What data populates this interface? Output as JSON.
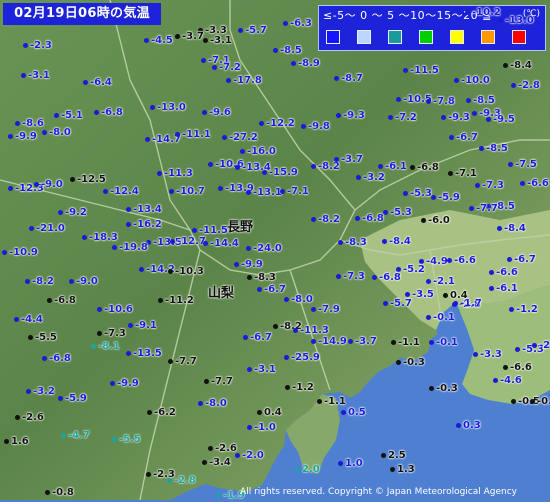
{
  "title": "02月19日06時の気温",
  "legend": {
    "scale_text": "≤-5〜 0 〜 5 〜10〜15〜20 ≦",
    "unit": "(℃)",
    "swatches": [
      {
        "name": "lt-neg5",
        "color": "#1414ff"
      },
      {
        "name": "neg5-0",
        "color": "#b9d7ff"
      },
      {
        "name": "0-5",
        "color": "#1a9a9a"
      },
      {
        "name": "5-10",
        "color": "#00d000"
      },
      {
        "name": "10-15",
        "color": "#ffff00"
      },
      {
        "name": "15-20",
        "color": "#ff9900"
      },
      {
        "name": "ge20",
        "color": "#ff0000"
      }
    ]
  },
  "colors": {
    "sea": "#4f7fd0",
    "land_low": "#a6bf7f",
    "land_high": "#5f8a4e",
    "cold": "#1b1ad8",
    "neutral": "#111111",
    "warm": "#1aa6a0"
  },
  "prefectures": {
    "nagano": "長野",
    "yamanashi": "山梨"
  },
  "temperatures": [
    "-3.3",
    "-5.7",
    "-6.3",
    "-2.3",
    "-4.5",
    "-3.7",
    "-3.1",
    "-7.1",
    "-8.5",
    "-8.9",
    "-10.2",
    "-13.0",
    "-3.1",
    "-6.4",
    "-7.2",
    "-17.8",
    "-8.7",
    "-11.5",
    "-10.0",
    "-2.8",
    "-8.4",
    "-9.3",
    "-10.5",
    "-7.8",
    "-8.5",
    "-8.6",
    "-5.1",
    "-6.8",
    "-13.0",
    "-9.6",
    "-12.2",
    "-9.8",
    "-9.3",
    "-7.2",
    "-6.7",
    "-9.3",
    "-9.5",
    "-9.9",
    "-8.0",
    "-14.7",
    "-11.1",
    "-27.2",
    "-8.5",
    "-16.0",
    "-10.6",
    "-13.4",
    "-8.2",
    "-3.7",
    "-6.1",
    "-6.8",
    "-7.1",
    "-7.5",
    "-6.6",
    "-15.9",
    "-11.3",
    "-3.2",
    "-12.3",
    "-9.0",
    "-12.5",
    "-12.4",
    "-10.7",
    "-13.9",
    "-13.1",
    "-7.1",
    "-5.3",
    "-5.9",
    "-7.3",
    "-8.5",
    "-9.2",
    "-13.4",
    "-5.3",
    "-6.0",
    "-7.7",
    "-8.4",
    "-21.0",
    "-16.2",
    "-6.8",
    "-8.2",
    "-18.3",
    "-11.5",
    "-13.5",
    "-12.7",
    "-14.4",
    "-24.0",
    "-8.3",
    "-8.4",
    "-4.9",
    "-6.6",
    "-6.7",
    "-10.9",
    "-19.8",
    "-9.9",
    "-5.2",
    "-6.6",
    "-8.2",
    "-14.2",
    "-10.3",
    "-8.3",
    "-7.3",
    "-6.8",
    "-2.1",
    "-6.1",
    "-9.0",
    "-6.7",
    "-3.5",
    "-0.1",
    "-2.8",
    "-6.8",
    "-10.6",
    "-11.2",
    "-8.0",
    "-7.9",
    "-5.7",
    "-1.7",
    "-1.2",
    "-4.4",
    "0.4",
    "-9.1",
    "-8.2",
    "-11.3",
    "-5.5",
    "-7.3",
    "-8.1",
    "-6.7",
    "-14.9",
    "-1.1",
    "-0.1",
    "-5.3",
    "-2.6",
    "-6.8",
    "-13.5",
    "-7.7",
    "-25.9",
    "-3.7",
    "-0.3",
    "-3.3",
    "-3.1",
    "-4.6",
    "-6.6",
    "-9.9",
    "-7.7",
    "-1.2",
    "-0.3",
    "-0.5",
    "-0.8",
    "-3.2",
    "-5.9",
    "-8.0",
    "-1.1",
    "-6.2",
    "0.4",
    "0.5",
    "-2.6",
    "-1.0",
    "0.3",
    "1.6",
    "-5.5",
    "-4.7",
    "-2.6",
    "-3.4",
    "-2.0",
    "2.0",
    "1.0",
    "2.5",
    "-2.3",
    "1.3",
    "-0.8",
    "-2.8",
    "-1.9"
  ],
  "labels": {
    "copyright": "All rights reserved. Copyright © Japan Meteorological Agency"
  }
}
